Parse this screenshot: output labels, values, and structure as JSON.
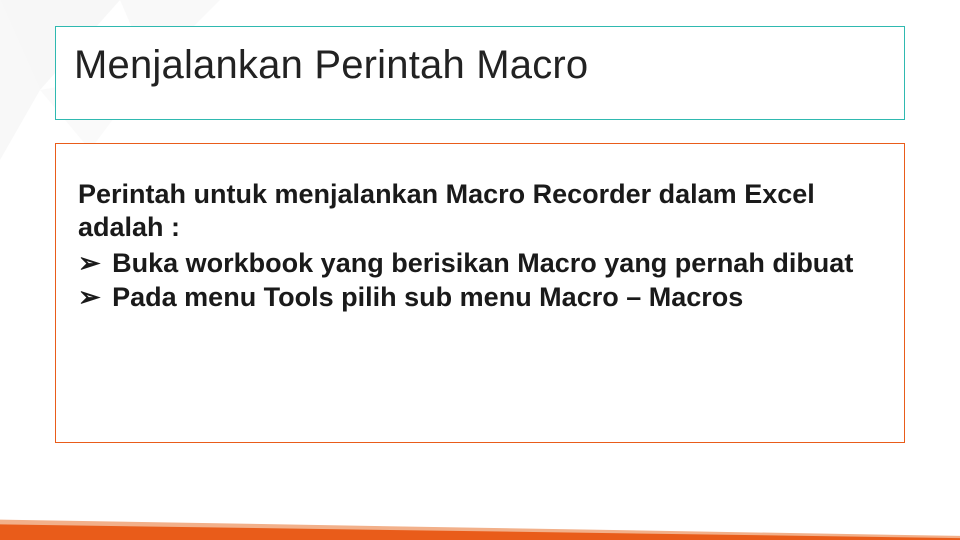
{
  "title": "Menjalankan Perintah Macro",
  "intro": "Perintah untuk menjalankan Macro Recorder dalam Excel adalah :",
  "bullets": [
    "Buka workbook yang berisikan Macro yang pernah dibuat",
    "Pada menu Tools pilih sub menu Macro – Macros"
  ],
  "bullet_glyph": "➢",
  "colors": {
    "title_border": "#2fb9b0",
    "content_border": "#e95c1a",
    "accent_orange": "#e95c1a",
    "accent_light": "#f2b08a"
  }
}
